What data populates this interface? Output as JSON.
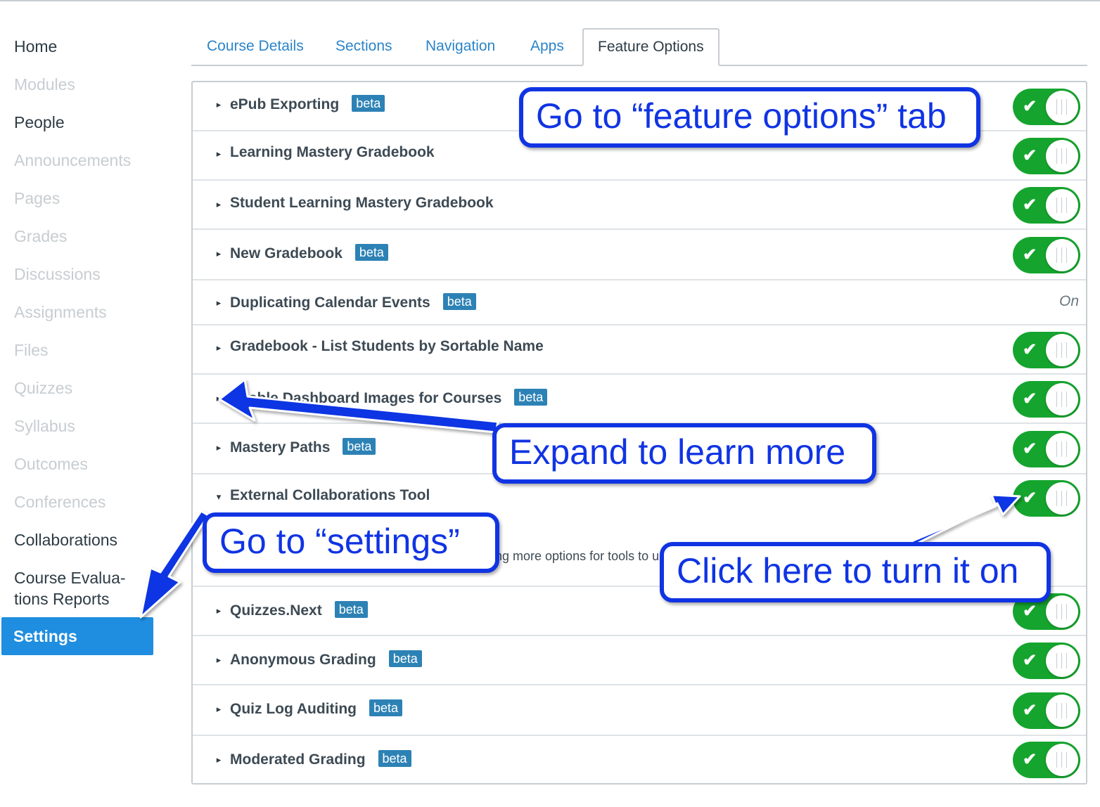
{
  "sidebar": {
    "items": [
      {
        "label": "Home",
        "enabled": true
      },
      {
        "label": "Modules",
        "enabled": false
      },
      {
        "label": "People",
        "enabled": true
      },
      {
        "label": "Announcements",
        "enabled": false
      },
      {
        "label": "Pages",
        "enabled": false
      },
      {
        "label": "Grades",
        "enabled": false
      },
      {
        "label": "Discussions",
        "enabled": false
      },
      {
        "label": "Assignments",
        "enabled": false
      },
      {
        "label": "Files",
        "enabled": false
      },
      {
        "label": "Quizzes",
        "enabled": false
      },
      {
        "label": "Syllabus",
        "enabled": false
      },
      {
        "label": "Outcomes",
        "enabled": false
      },
      {
        "label": "Conferences",
        "enabled": false
      },
      {
        "label": "Collaborations",
        "enabled": true
      },
      {
        "label": "Course Evalua-tions Reports",
        "enabled": true
      },
      {
        "label": "Settings",
        "enabled": true,
        "active": true
      }
    ]
  },
  "tabs": [
    {
      "label": "Course Details"
    },
    {
      "label": "Sections"
    },
    {
      "label": "Navigation"
    },
    {
      "label": "Apps"
    },
    {
      "label": "Feature Options",
      "active": true
    }
  ],
  "features": [
    {
      "name": "ePub Exporting",
      "badge": "beta",
      "control": "toggle",
      "on": true
    },
    {
      "name": "Learning Mastery Gradebook",
      "control": "toggle",
      "on": true
    },
    {
      "name": "Student Learning Mastery Gradebook",
      "control": "toggle",
      "on": true
    },
    {
      "name": "New Gradebook",
      "badge": "beta",
      "control": "toggle",
      "on": true
    },
    {
      "name": "Duplicating Calendar Events",
      "badge": "beta",
      "control": "text",
      "state_text": "On"
    },
    {
      "name": "Gradebook - List Students by Sortable Name",
      "control": "toggle",
      "on": true
    },
    {
      "name": "Enable Dashboard Images for Courses",
      "badge": "beta",
      "control": "toggle",
      "on": true
    },
    {
      "name": "Mastery Paths",
      "badge": "beta",
      "control": "toggle",
      "on": true
    },
    {
      "name": "External Collaborations Tool",
      "control": "toggle",
      "on": true,
      "expanded": true,
      "description": "ng more options for tools to u"
    },
    {
      "name": "Quizzes.Next",
      "badge": "beta",
      "control": "toggle",
      "on": true
    },
    {
      "name": "Anonymous Grading",
      "badge": "beta",
      "control": "toggle",
      "on": true
    },
    {
      "name": "Quiz Log Auditing",
      "badge": "beta",
      "control": "toggle",
      "on": true
    },
    {
      "name": "Moderated Grading",
      "badge": "beta",
      "control": "toggle",
      "on": true
    }
  ],
  "callouts": {
    "feature_options": "Go to “feature options” tab",
    "expand": "Expand to learn more",
    "settings": "Go to “settings”",
    "turn_on": "Click here to turn it on"
  },
  "colors": {
    "accent": "#1f8ee0",
    "toggle_on": "#15a52e",
    "badge": "#2d82b5",
    "callout": "#1034e3",
    "link": "#2b84c9"
  }
}
